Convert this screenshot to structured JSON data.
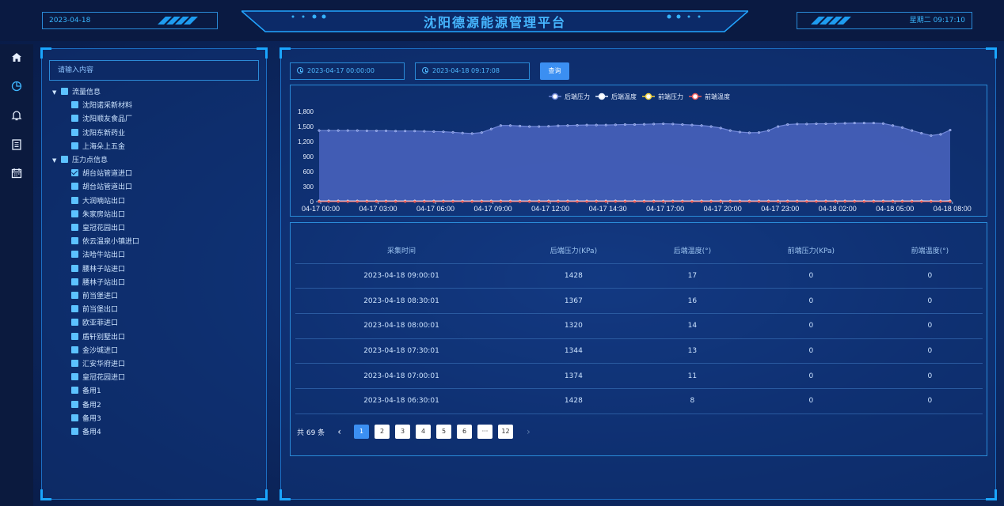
{
  "header": {
    "date": "2023-04-18",
    "title": "沈阳德源能源管理平台",
    "datetime": "星期二 09:17:10"
  },
  "nav": {
    "icons": [
      "home-icon",
      "chart-icon",
      "bell-icon",
      "document-icon",
      "calendar-icon"
    ]
  },
  "sidebar": {
    "search_placeholder": "请输入内容",
    "groups": [
      {
        "label": "流量信息",
        "items": [
          "沈阳诺采新材料",
          "沈阳顺友食品厂",
          "沈阳东新药业",
          "上海朵上五金"
        ]
      },
      {
        "label": "压力点信息",
        "items": [
          "胡台站管道进口",
          "胡台站管道出口",
          "大润喃站出口",
          "朱家房站出口",
          "皇冠花园出口",
          "依云温泉小镇进口",
          "法哈牛站出口",
          "腰林子站进口",
          "腰林子站出口",
          "前当堡进口",
          "前当堡出口",
          "欧亚菲进口",
          "盾轩别墅出口",
          "金沙城进口",
          "汇安华府进口",
          "皇冠花园进口",
          "备用1",
          "备用2",
          "备用3",
          "备用4"
        ],
        "checked_index": 0
      }
    ]
  },
  "filters": {
    "start": "2023-04-17 00:00:00",
    "end": "2023-04-18 09:17:08",
    "query_label": "查询"
  },
  "chart_data": {
    "type": "area",
    "legend": [
      "后端压力",
      "后端温度",
      "前端压力",
      "前端温度"
    ],
    "legend_position": "top-center",
    "x_ticks": [
      "04-17 00:00",
      "04-17 03:00",
      "04-17 06:00",
      "04-17 09:00",
      "04-17 12:00",
      "04-17 14:30",
      "04-17 17:00",
      "04-17 20:00",
      "04-17 23:00",
      "04-18 02:00",
      "04-18 05:00",
      "04-18 08:00"
    ],
    "y_ticks": [
      "0",
      "300",
      "600",
      "900",
      "1,200",
      "1,500",
      "1,800"
    ],
    "ylim": [
      0,
      1800
    ],
    "grid": false,
    "series": [
      {
        "name": "后端压力",
        "color": "#6f86d8",
        "values": [
          1420,
          1420,
          1420,
          1420,
          1420,
          1415,
          1415,
          1415,
          1410,
          1410,
          1410,
          1405,
          1400,
          1395,
          1385,
          1370,
          1360,
          1380,
          1450,
          1520,
          1520,
          1510,
          1500,
          1500,
          1505,
          1515,
          1520,
          1525,
          1530,
          1530,
          1530,
          1535,
          1540,
          1540,
          1545,
          1550,
          1555,
          1550,
          1540,
          1530,
          1520,
          1500,
          1470,
          1420,
          1390,
          1375,
          1380,
          1420,
          1500,
          1540,
          1550,
          1550,
          1555,
          1555,
          1560,
          1565,
          1570,
          1570,
          1570,
          1560,
          1520,
          1480,
          1420,
          1367,
          1320,
          1344,
          1428
        ]
      },
      {
        "name": "后端温度",
        "color": "#e8f0ff",
        "values": [
          15,
          15,
          15,
          15,
          15,
          15,
          15,
          15,
          15,
          15,
          15,
          15,
          15,
          15,
          15,
          15,
          15,
          15,
          15,
          15,
          15,
          15,
          15,
          15,
          15,
          15,
          15,
          15,
          15,
          15,
          15,
          15,
          15,
          15,
          15,
          15,
          15,
          15,
          15,
          15,
          15,
          15,
          15,
          15,
          15,
          15,
          15,
          15,
          15,
          15,
          15,
          15,
          15,
          15,
          15,
          15,
          15,
          15,
          15,
          15,
          15,
          15,
          15,
          16,
          14,
          13,
          17
        ]
      },
      {
        "name": "前端压力",
        "color": "#f0d23c",
        "values": [
          0,
          0,
          0,
          0,
          0,
          0,
          0,
          0,
          0,
          0,
          0,
          0,
          0,
          0,
          0,
          0,
          0,
          0,
          0,
          0,
          0,
          0,
          0,
          0,
          0,
          0,
          0,
          0,
          0,
          0,
          0,
          0,
          0,
          0,
          0,
          0,
          0,
          0,
          0,
          0,
          0,
          0,
          0,
          0,
          0,
          0,
          0,
          0,
          0,
          0,
          0,
          0,
          0,
          0,
          0,
          0,
          0,
          0,
          0,
          0,
          0,
          0,
          0,
          0,
          0,
          0,
          0
        ]
      },
      {
        "name": "前端温度",
        "color": "#ef5b5b",
        "values": [
          0,
          0,
          0,
          0,
          0,
          0,
          0,
          0,
          0,
          0,
          0,
          0,
          0,
          0,
          0,
          0,
          0,
          0,
          0,
          0,
          0,
          0,
          0,
          0,
          0,
          0,
          0,
          0,
          0,
          0,
          0,
          0,
          0,
          0,
          0,
          0,
          0,
          0,
          0,
          0,
          0,
          0,
          0,
          0,
          0,
          0,
          0,
          0,
          0,
          0,
          0,
          0,
          0,
          0,
          0,
          0,
          0,
          0,
          0,
          0,
          0,
          0,
          0,
          0,
          0,
          0,
          0
        ]
      }
    ]
  },
  "table": {
    "headers": [
      "采集时间",
      "后端压力(KPa)",
      "后端温度(°)",
      "前端压力(KPa)",
      "前端温度(°)"
    ],
    "rows": [
      [
        "2023-04-18 09:00:01",
        "1428",
        "17",
        "0",
        "0"
      ],
      [
        "2023-04-18 08:30:01",
        "1367",
        "16",
        "0",
        "0"
      ],
      [
        "2023-04-18 08:00:01",
        "1320",
        "14",
        "0",
        "0"
      ],
      [
        "2023-04-18 07:30:01",
        "1344",
        "13",
        "0",
        "0"
      ],
      [
        "2023-04-18 07:00:01",
        "1374",
        "11",
        "0",
        "0"
      ],
      [
        "2023-04-18 06:30:01",
        "1428",
        "8",
        "0",
        "0"
      ]
    ]
  },
  "pagination": {
    "total": "共 69 条",
    "prev": "‹",
    "next": "›",
    "pages": [
      "1",
      "2",
      "3",
      "4",
      "5",
      "6",
      "···",
      "12"
    ],
    "current": "1"
  },
  "colors": {
    "accent": "#3b8ff2",
    "title": "#46b6ff",
    "border": "#2a8bd8"
  }
}
